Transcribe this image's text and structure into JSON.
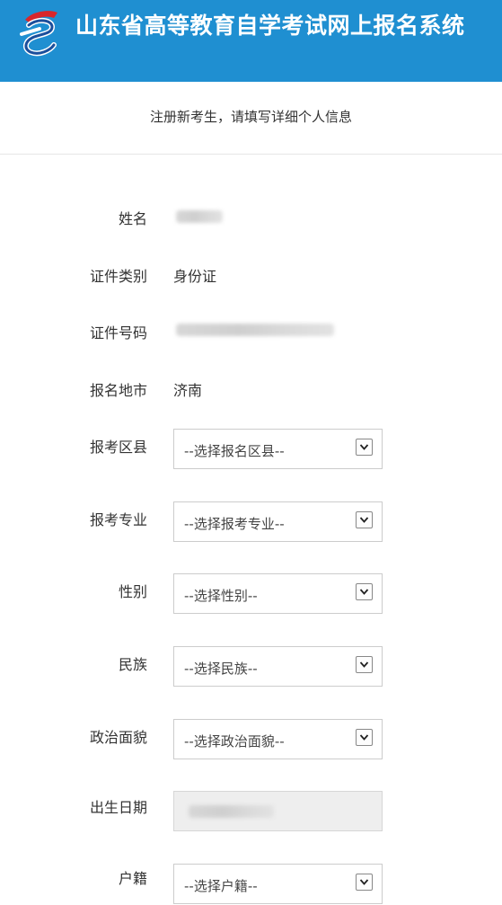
{
  "header": {
    "title": "山东省高等教育自学考试网上报名系统",
    "background": "#1f8fd1"
  },
  "subheader": {
    "text": "注册新考生，请填写详细个人信息"
  },
  "form": {
    "name": {
      "label": "姓名"
    },
    "id_type": {
      "label": "证件类别",
      "value": "身份证"
    },
    "id_number": {
      "label": "证件号码"
    },
    "city": {
      "label": "报名地市",
      "value": "济南"
    },
    "district": {
      "label": "报考区县",
      "placeholder": "--选择报名区县--"
    },
    "major": {
      "label": "报考专业",
      "placeholder": "--选择报考专业--"
    },
    "gender": {
      "label": "性别",
      "placeholder": "--选择性别--"
    },
    "ethnicity": {
      "label": "民族",
      "placeholder": "--选择民族--"
    },
    "political_status": {
      "label": "政治面貌",
      "placeholder": "--选择政治面貌--"
    },
    "birth_date": {
      "label": "出生日期"
    },
    "household": {
      "label": "户籍",
      "placeholder": "--选择户籍--"
    }
  }
}
